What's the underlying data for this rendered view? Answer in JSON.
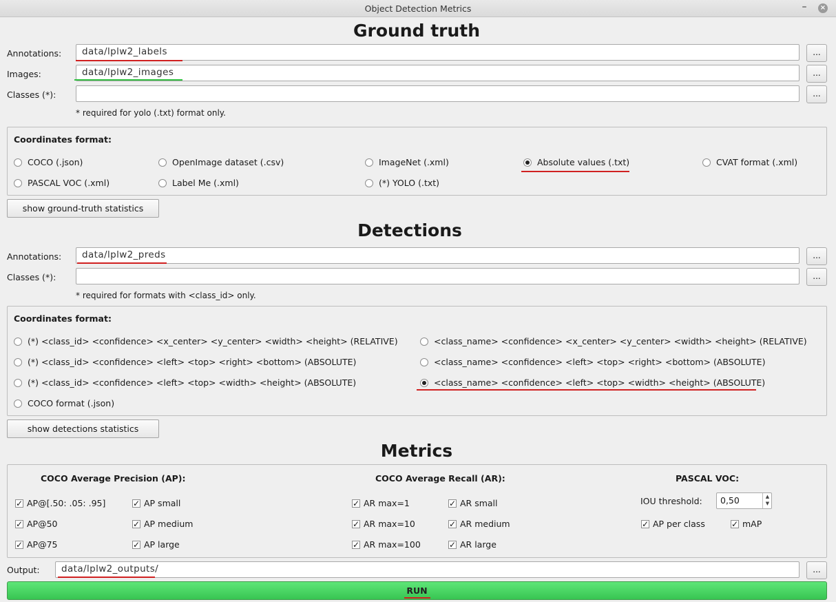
{
  "window": {
    "title": "Object Detection Metrics",
    "minimize_glyph": "–",
    "close_glyph": "×"
  },
  "ground_truth": {
    "heading": "Ground truth",
    "annotations_label": "Annotations:",
    "annotations_value": "data/lplw2_labels",
    "images_label": "Images:",
    "images_value": "data/lplw2_images",
    "classes_label": "Classes (*):",
    "classes_value": "",
    "browse_label": "...",
    "note": "* required for yolo (.txt) format only.",
    "format_title": "Coordinates format:",
    "formats": [
      "COCO (.json)",
      "OpenImage dataset (.csv)",
      "ImageNet (.xml)",
      "Absolute values (.txt)",
      "CVAT format (.xml)",
      "PASCAL VOC (.xml)",
      "Label Me (.xml)",
      "(*) YOLO (.txt)"
    ],
    "selected_format": "Absolute values (.txt)",
    "stats_button": "show ground-truth statistics"
  },
  "detections": {
    "heading": "Detections",
    "annotations_label": "Annotations:",
    "annotations_value": "data/lplw2_preds",
    "classes_label": "Classes (*):",
    "classes_value": "",
    "browse_label": "...",
    "note": "* required for formats with <class_id> only.",
    "format_title": "Coordinates format:",
    "formats": [
      "(*) <class_id> <confidence> <x_center> <y_center> <width> <height> (RELATIVE)",
      "<class_name> <confidence> <x_center> <y_center> <width> <height> (RELATIVE)",
      "(*) <class_id> <confidence> <left> <top> <right> <bottom> (ABSOLUTE)",
      "<class_name> <confidence> <left> <top> <right> <bottom> (ABSOLUTE)",
      "(*) <class_id> <confidence> <left> <top> <width> <height> (ABSOLUTE)",
      "<class_name> <confidence> <left> <top> <width> <height> (ABSOLUTE)",
      "COCO format (.json)"
    ],
    "selected_format": "<class_name> <confidence> <left> <top> <width> <height> (ABSOLUTE)",
    "stats_button": "show detections statistics"
  },
  "metrics": {
    "heading": "Metrics",
    "coco_ap_title": "COCO Average Precision (AP):",
    "coco_ap": [
      {
        "label": "AP@[.50: .05: .95]",
        "checked": true
      },
      {
        "label": "AP small",
        "checked": true
      },
      {
        "label": "AP@50",
        "checked": true
      },
      {
        "label": "AP medium",
        "checked": true
      },
      {
        "label": "AP@75",
        "checked": true
      },
      {
        "label": "AP large",
        "checked": true
      }
    ],
    "coco_ar_title": "COCO Average Recall (AR):",
    "coco_ar": [
      {
        "label": "AR max=1",
        "checked": true
      },
      {
        "label": "AR small",
        "checked": true
      },
      {
        "label": "AR max=10",
        "checked": true
      },
      {
        "label": "AR medium",
        "checked": true
      },
      {
        "label": "AR max=100",
        "checked": true
      },
      {
        "label": "AR large",
        "checked": true
      }
    ],
    "voc_title": "PASCAL VOC:",
    "iou_label": "IOU threshold:",
    "iou_value": "0,50",
    "voc": [
      {
        "label": "AP per class",
        "checked": true
      },
      {
        "label": "mAP",
        "checked": true
      }
    ],
    "check_glyph": "✓"
  },
  "output": {
    "label": "Output:",
    "value": "data/lplw2_outputs/",
    "browse_label": "..."
  },
  "run_label": "RUN",
  "colors": {
    "underline_red": "#d02020",
    "underline_green": "#30c040",
    "run_green": "#44d35e"
  }
}
